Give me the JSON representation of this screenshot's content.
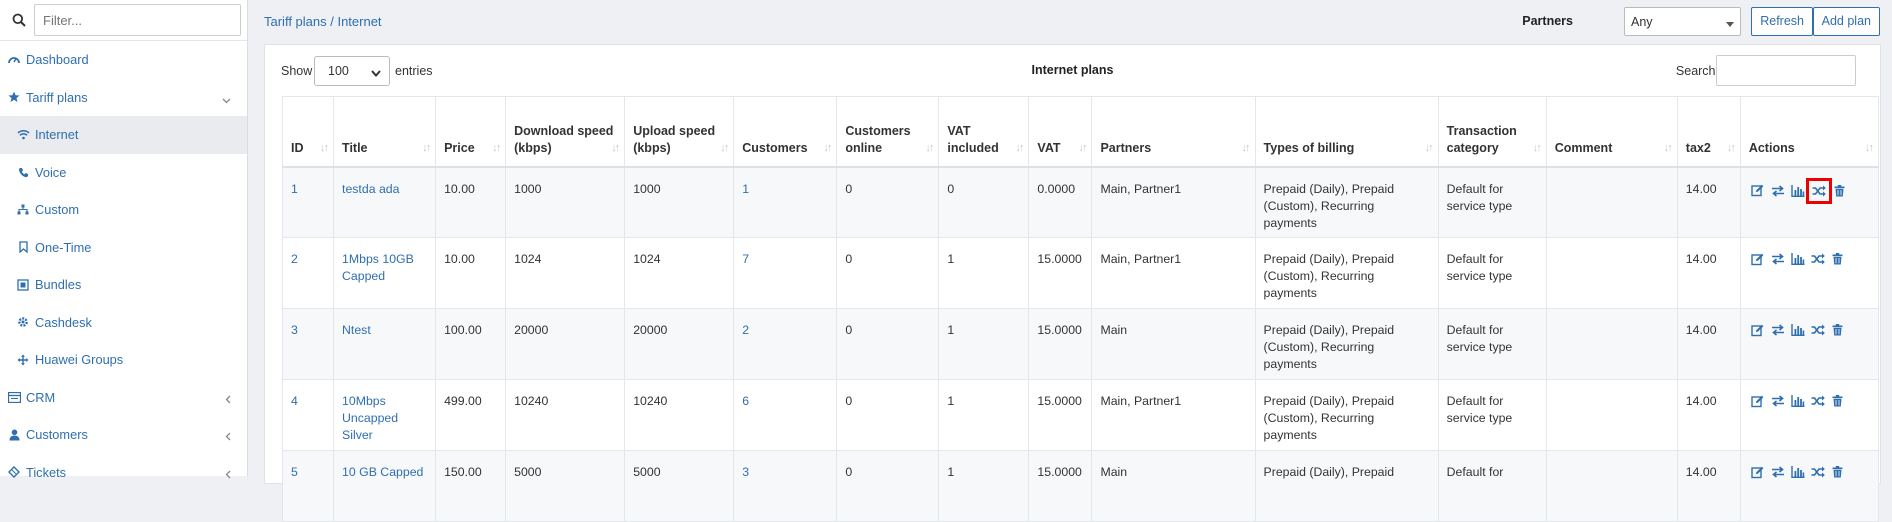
{
  "sidebar": {
    "filter_placeholder": "Filter...",
    "items": [
      {
        "label": "Dashboard"
      },
      {
        "label": "Tariff plans"
      },
      {
        "label": "Internet"
      },
      {
        "label": "Voice"
      },
      {
        "label": "Custom"
      },
      {
        "label": "One-Time"
      },
      {
        "label": "Bundles"
      },
      {
        "label": "Cashdesk"
      },
      {
        "label": "Huawei Groups"
      },
      {
        "label": "CRM"
      },
      {
        "label": "Customers"
      },
      {
        "label": "Tickets"
      }
    ]
  },
  "header": {
    "breadcrumb": "Tariff plans / Internet",
    "partners_label": "Partners",
    "partners_value": "Any",
    "refresh_label": "Refresh",
    "add_plan_label": "Add plan"
  },
  "panel": {
    "title": "Internet plans",
    "show_label": "Show",
    "entries_value": "100",
    "entries_label": "entries",
    "search_label": "Search:"
  },
  "table": {
    "columns": [
      "ID",
      "Title",
      "Price",
      "Download speed (kbps)",
      "Upload speed (kbps)",
      "Customers",
      "Customers online",
      "VAT included",
      "VAT",
      "Partners",
      "Types of billing",
      "Transaction category",
      "Comment",
      "tax2",
      "Actions"
    ],
    "rows": [
      {
        "id": "1",
        "title": "testda ada",
        "price": "10.00",
        "down": "1000",
        "up": "1000",
        "customers": "1",
        "online": "0",
        "vat_inc": "0",
        "vat": "0.0000",
        "partners": "Main, Partner1",
        "billing": "Prepaid (Daily), Prepaid (Custom), Recurring payments",
        "category": "Default for service type",
        "comment": "",
        "tax2": "14.00"
      },
      {
        "id": "2",
        "title": "1Mbps 10GB Capped",
        "price": "10.00",
        "down": "1024",
        "up": "1024",
        "customers": "7",
        "online": "0",
        "vat_inc": "1",
        "vat": "15.0000",
        "partners": "Main, Partner1",
        "billing": "Prepaid (Daily), Prepaid (Custom), Recurring payments",
        "category": "Default for service type",
        "comment": "",
        "tax2": "14.00"
      },
      {
        "id": "3",
        "title": "Ntest",
        "price": "100.00",
        "down": "20000",
        "up": "20000",
        "customers": "2",
        "online": "0",
        "vat_inc": "1",
        "vat": "15.0000",
        "partners": "Main",
        "billing": "Prepaid (Daily), Prepaid (Custom), Recurring payments",
        "category": "Default for service type",
        "comment": "",
        "tax2": "14.00"
      },
      {
        "id": "4",
        "title": "10Mbps Uncapped Silver",
        "price": "499.00",
        "down": "10240",
        "up": "10240",
        "customers": "6",
        "online": "0",
        "vat_inc": "1",
        "vat": "15.0000",
        "partners": "Main, Partner1",
        "billing": "Prepaid (Daily), Prepaid (Custom), Recurring payments",
        "category": "Default for service type",
        "comment": "",
        "tax2": "14.00"
      },
      {
        "id": "5",
        "title": "10 GB Capped",
        "price": "150.00",
        "down": "5000",
        "up": "5000",
        "customers": "3",
        "online": "0",
        "vat_inc": "1",
        "vat": "15.0000",
        "partners": "Main",
        "billing": "Prepaid (Daily), Prepaid",
        "category": "Default for",
        "comment": "",
        "tax2": "14.00"
      }
    ]
  },
  "colors": {
    "link": "#2f6fb0",
    "highlight": "#e00000"
  },
  "action_icons": [
    "edit-icon",
    "change-plan-icon",
    "statistics-icon",
    "shuffle-icon",
    "delete-icon"
  ]
}
